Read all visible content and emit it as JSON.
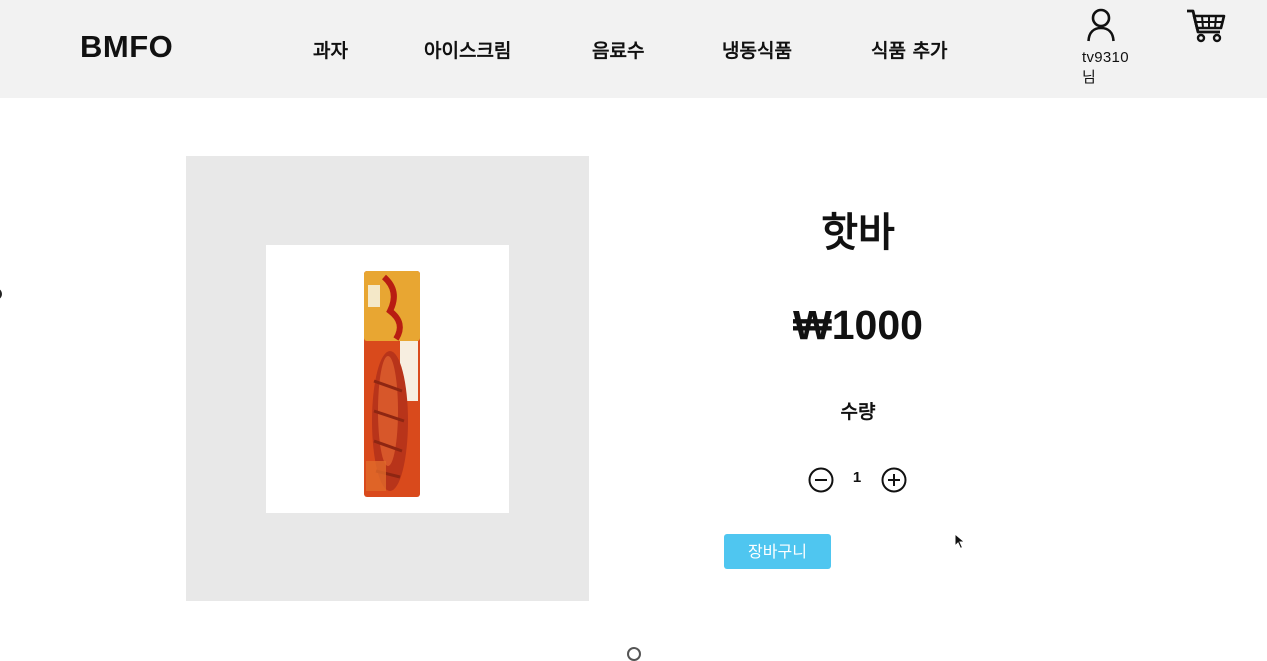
{
  "header": {
    "logo": "BMFO",
    "nav": [
      "과자",
      "아이스크림",
      "음료수",
      "냉동식품",
      "식품 추가"
    ],
    "user": {
      "icon": "user-icon",
      "name_line1": "tv9310",
      "name_line2": "님"
    },
    "cart_icon": "shopping-cart-icon"
  },
  "product": {
    "name": "핫바",
    "price": "₩1000",
    "quantity_label": "수량",
    "quantity": "1",
    "add_to_cart_label": "장바구니"
  },
  "colors": {
    "header_bg": "#f2f2f2",
    "image_panel_bg": "#e8e8e8",
    "cart_button_bg": "#4fc6f0",
    "cart_button_text": "#ffffff"
  }
}
